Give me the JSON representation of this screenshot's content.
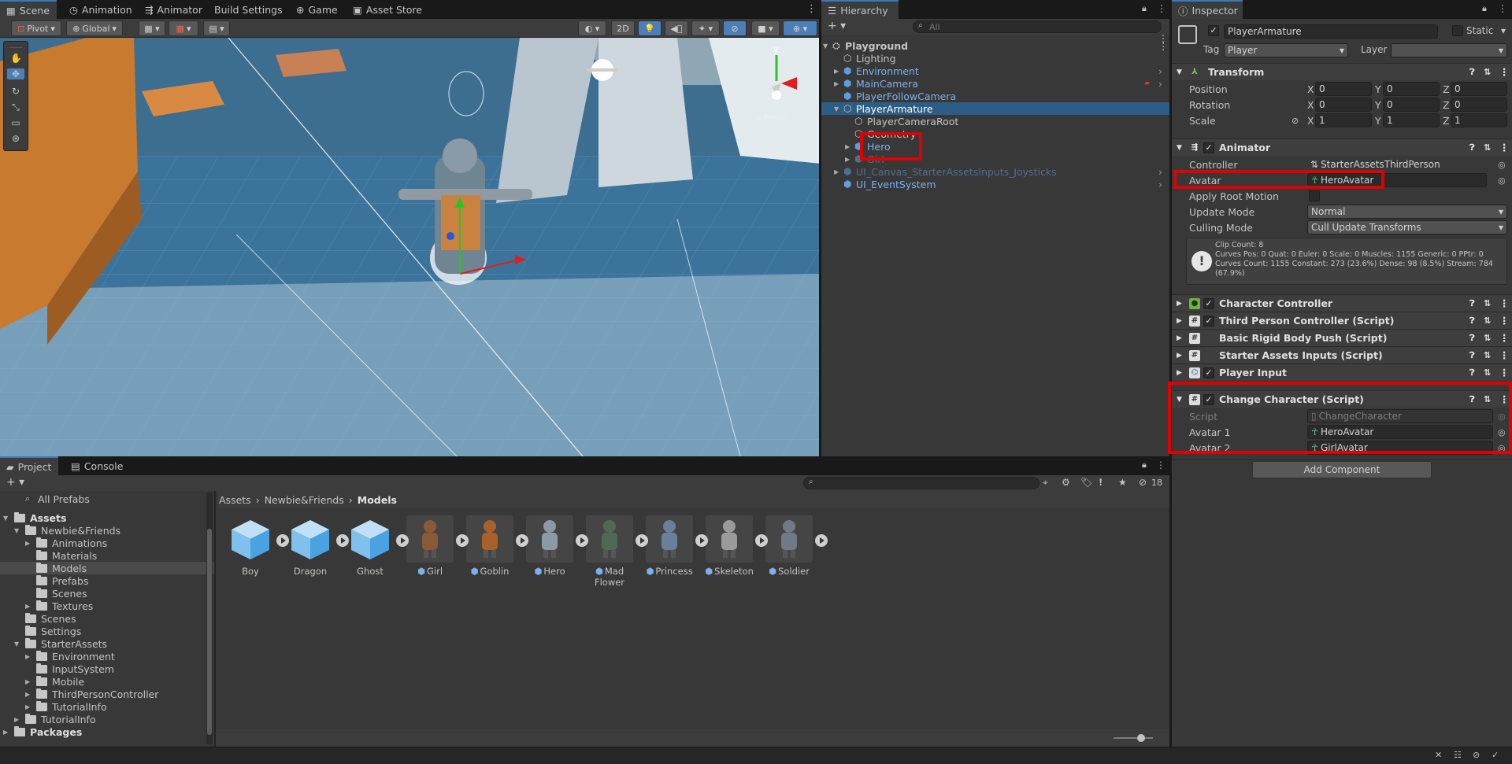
{
  "scene_tabs": [
    {
      "label": "Scene",
      "icon": "scene-grid-icon"
    },
    {
      "label": "Animation",
      "icon": "animation-clock-icon"
    },
    {
      "label": "Animator",
      "icon": "animator-icon"
    },
    {
      "label": "Build Settings",
      "icon": ""
    },
    {
      "label": "Game",
      "icon": "gamepad-icon"
    },
    {
      "label": "Asset Store",
      "icon": "store-bag-icon"
    }
  ],
  "scene_toolbar": {
    "pivot": "Pivot",
    "global": "Global",
    "mode_2d": "2D"
  },
  "scene_view": {
    "persp_label": "<Persp"
  },
  "hierarchy": {
    "tab": "Hierarchy",
    "search_placeholder": "All",
    "items": [
      {
        "label": "Playground",
        "depth": 0,
        "style": "bold"
      },
      {
        "label": "Lighting",
        "depth": 1,
        "style": "normal"
      },
      {
        "label": "Environment",
        "depth": 1,
        "style": "prefab"
      },
      {
        "label": "MainCamera",
        "depth": 1,
        "style": "prefab"
      },
      {
        "label": "PlayerFollowCamera",
        "depth": 1,
        "style": "prefab"
      },
      {
        "label": "PlayerArmature",
        "depth": 1,
        "style": "selected"
      },
      {
        "label": "PlayerCameraRoot",
        "depth": 2,
        "style": "normal"
      },
      {
        "label": "Geometry",
        "depth": 2,
        "style": "normal"
      },
      {
        "label": "Hero",
        "depth": 2,
        "style": "prefab"
      },
      {
        "label": "Girl",
        "depth": 2,
        "style": "prefab-dim"
      },
      {
        "label": "UI_Canvas_StarterAssetsInputs_Joysticks",
        "depth": 1,
        "style": "prefab-dim"
      },
      {
        "label": "UI_EventSystem",
        "depth": 1,
        "style": "prefab"
      }
    ]
  },
  "inspector": {
    "tab": "Inspector",
    "object_name": "PlayerArmature",
    "static_label": "Static",
    "tag_label": "Tag",
    "tag_value": "Player",
    "layer_label": "Layer",
    "transform": {
      "title": "Transform",
      "rows": [
        {
          "label": "Position",
          "x": "0",
          "y": "0",
          "z": "0"
        },
        {
          "label": "Rotation",
          "x": "0",
          "y": "0",
          "z": "0"
        },
        {
          "label": "Scale",
          "x": "1",
          "y": "1",
          "z": "1"
        }
      ]
    },
    "animator": {
      "title": "Animator",
      "controller_label": "Controller",
      "controller_value": "StarterAssetsThirdPerson",
      "avatar_label": "Avatar",
      "avatar_value": "HeroAvatar",
      "root_motion_label": "Apply Root Motion",
      "update_label": "Update Mode",
      "update_value": "Normal",
      "culling_label": "Culling Mode",
      "culling_value": "Cull Update Transforms",
      "info_lines": [
        "Clip Count: 8",
        "Curves Pos: 0 Quat: 0 Euler: 0 Scale: 0 Muscles: 1155 Generic: 0 PPtr: 0",
        "Curves Count: 1155 Constant: 273 (23.6%) Dense: 98 (8.5%) Stream: 784",
        "(67.9%)"
      ]
    },
    "components": [
      {
        "title": "Character Controller",
        "checked": true,
        "icon": "character-controller-icon"
      },
      {
        "title": "Third Person Controller (Script)",
        "checked": true,
        "icon": "script-hash-icon"
      },
      {
        "title": "Basic Rigid Body Push (Script)",
        "checked": false,
        "icon": "script-hash-icon"
      },
      {
        "title": "Starter Assets Inputs (Script)",
        "checked": false,
        "icon": "script-hash-icon"
      },
      {
        "title": "Player Input",
        "checked": true,
        "icon": "player-input-icon"
      }
    ],
    "change_character": {
      "title": "Change Character (Script)",
      "script_label": "Script",
      "script_value": "ChangeCharacter",
      "avatar1_label": "Avatar 1",
      "avatar1_value": "HeroAvatar",
      "avatar2_label": "Avatar 2",
      "avatar2_value": "GirlAvatar"
    },
    "add_component": "Add Component"
  },
  "project": {
    "tabs": [
      "Project",
      "Console"
    ],
    "breadcrumb": [
      "Assets",
      "Newbie&Friends",
      "Models"
    ],
    "hidden_count": "18",
    "tree": [
      {
        "label": "All Prefabs",
        "depth": 0,
        "kind": "search"
      },
      {
        "label": "Assets",
        "depth": 0,
        "kind": "folder-bold",
        "arrow": "open"
      },
      {
        "label": "Newbie&Friends",
        "depth": 1,
        "kind": "folder",
        "arrow": "open"
      },
      {
        "label": "Animations",
        "depth": 2,
        "kind": "folder",
        "arrow": "closed"
      },
      {
        "label": "Materials",
        "depth": 2,
        "kind": "folder",
        "arrow": ""
      },
      {
        "label": "Models",
        "depth": 2,
        "kind": "folder",
        "arrow": "",
        "selected": true
      },
      {
        "label": "Prefabs",
        "depth": 2,
        "kind": "folder",
        "arrow": ""
      },
      {
        "label": "Scenes",
        "depth": 2,
        "kind": "folder",
        "arrow": ""
      },
      {
        "label": "Textures",
        "depth": 2,
        "kind": "folder",
        "arrow": "closed"
      },
      {
        "label": "Scenes",
        "depth": 1,
        "kind": "folder",
        "arrow": ""
      },
      {
        "label": "Settings",
        "depth": 1,
        "kind": "folder",
        "arrow": ""
      },
      {
        "label": "StarterAssets",
        "depth": 1,
        "kind": "folder",
        "arrow": "open"
      },
      {
        "label": "Environment",
        "depth": 2,
        "kind": "folder",
        "arrow": "closed"
      },
      {
        "label": "InputSystem",
        "depth": 2,
        "kind": "folder",
        "arrow": ""
      },
      {
        "label": "Mobile",
        "depth": 2,
        "kind": "folder",
        "arrow": "closed"
      },
      {
        "label": "ThirdPersonController",
        "depth": 2,
        "kind": "folder",
        "arrow": "closed"
      },
      {
        "label": "TutorialInfo",
        "depth": 2,
        "kind": "folder",
        "arrow": "closed"
      },
      {
        "label": "TutorialInfo",
        "depth": 1,
        "kind": "folder",
        "arrow": "closed"
      },
      {
        "label": "Packages",
        "depth": 0,
        "kind": "folder-bold",
        "arrow": "closed"
      }
    ],
    "assets": [
      {
        "label": "Boy",
        "kind": "cube"
      },
      {
        "label": "Dragon",
        "kind": "cube"
      },
      {
        "label": "Ghost",
        "kind": "cube"
      },
      {
        "label": "Girl",
        "kind": "model"
      },
      {
        "label": "Goblin",
        "kind": "model"
      },
      {
        "label": "Hero",
        "kind": "model"
      },
      {
        "label": "Mad Flower",
        "kind": "model"
      },
      {
        "label": "Princess",
        "kind": "model"
      },
      {
        "label": "Skeleton",
        "kind": "model"
      },
      {
        "label": "Soldier",
        "kind": "model"
      }
    ]
  },
  "colors": {
    "highlight_box": "#e00000",
    "selection": "#2c5d87",
    "prefab_text": "#7bb0ec"
  }
}
